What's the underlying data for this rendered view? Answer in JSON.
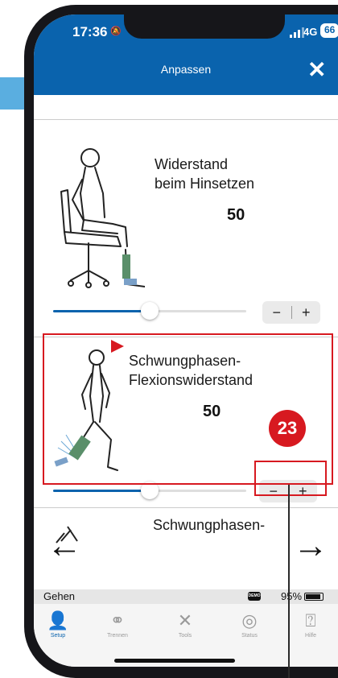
{
  "status_bar": {
    "time": "17:36",
    "network": "4G",
    "battery": "66"
  },
  "header": {
    "title": "Anpassen"
  },
  "settings": [
    {
      "label_line1": "Widerstand",
      "label_line2": "beim Hinsetzen",
      "value": "50",
      "slider_fraction": 0.5,
      "decrement": "−",
      "increment": "+"
    },
    {
      "label_line1": "Schwungphasen-",
      "label_line2": "Flexionswiderstand",
      "value": "50",
      "slider_fraction": 0.5,
      "decrement": "−",
      "increment": "+"
    },
    {
      "label_line1": "Schwungphasen-"
    }
  ],
  "callout": {
    "number": "23"
  },
  "nav": {
    "back": "←",
    "forward": "→"
  },
  "status_strip": {
    "mode": "Gehen",
    "demo_badge": "DEMO",
    "battery_percent": "95%"
  },
  "tabs": [
    {
      "label": "Setup",
      "icon": "user-gear-icon",
      "active": true
    },
    {
      "label": "Trennen",
      "icon": "unlink-icon",
      "active": false
    },
    {
      "label": "Tools",
      "icon": "tools-icon",
      "active": false
    },
    {
      "label": "Status",
      "icon": "status-icon",
      "active": false
    },
    {
      "label": "Hilfe",
      "icon": "help-icon",
      "active": false
    }
  ],
  "colors": {
    "brand_blue": "#0a63ad",
    "highlight_red": "#d71920"
  }
}
